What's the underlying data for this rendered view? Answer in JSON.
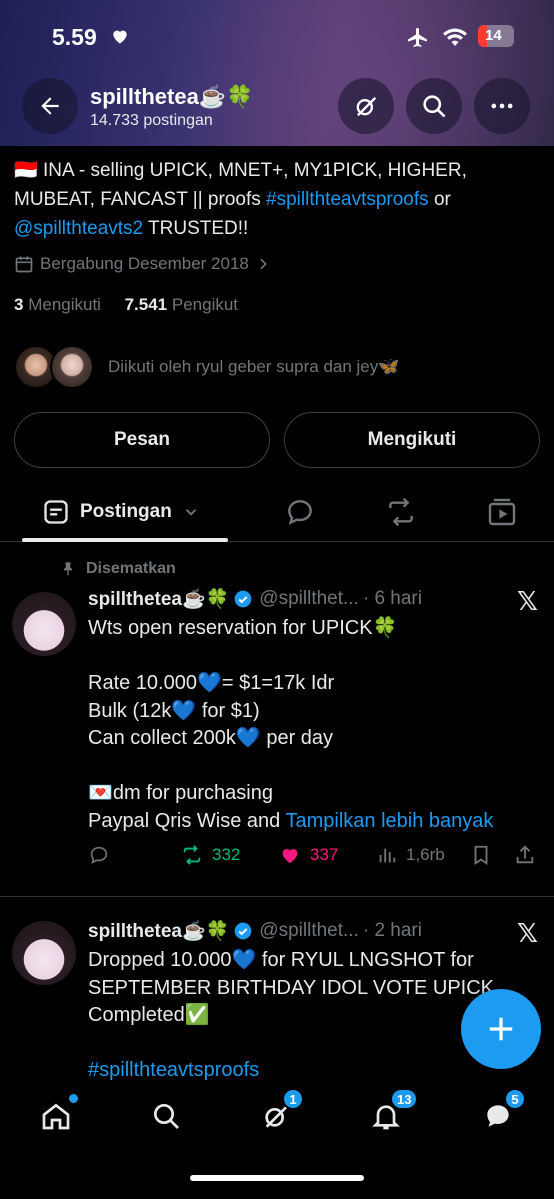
{
  "status_bar": {
    "time": "5.59",
    "battery": "14"
  },
  "header": {
    "name": "spillthetea☕️🍀",
    "post_count": "14.733 postingan"
  },
  "profile": {
    "bio_flag": "🇮🇩",
    "bio_line1": " INA - selling UPICK, MNET+, MY1PICK, HIGHER,",
    "bio_line2_a": "MUBEAT, FANCAST || proofs ",
    "bio_hashtag": "#spillthteavtsproofs",
    "bio_line2_b": " or",
    "bio_mention": "@spillthteavts2",
    "bio_line3_b": " TRUSTED!!",
    "joined": "Bergabung Desember 2018",
    "following_count": "3",
    "following_label": "Mengikuti",
    "followers_count": "7.541",
    "followers_label": "Pengikut",
    "followed_by": "Diikuti oleh ryul geber supra dan jey🦋",
    "message_button": "Pesan",
    "following_button": "Mengikuti"
  },
  "tabs": {
    "active_label": "Postingan"
  },
  "posts": [
    {
      "pinned_label": "Disematkan",
      "name": "spillthetea☕️🍀",
      "handle": "@spillthet...",
      "time": "· 6 hari",
      "lines": [
        "Wts  open reservation for UPICK🍀",
        "",
        "Rate 10.000💙= $1=17k Idr",
        "Bulk (12k💙  for $1)",
        "Can collect 200k💙  per day",
        "",
        "💌dm for purchasing"
      ],
      "last_line": "Paypal Qris Wise and ",
      "show_more": "Tampilkan lebih banyak",
      "retweets": "332",
      "likes": "337",
      "views": "1,6rb"
    },
    {
      "name": "spillthetea☕️🍀",
      "handle": "@spillthet...",
      "time": "· 2 hari",
      "lines": [
        "Dropped 10.000💙  for RYUL LNGSHOT for",
        "SEPTEMBER BIRTHDAY IDOL VOTE UPICK",
        "Completed✅",
        ""
      ],
      "hashtag": "#spillthteavtsproofs"
    }
  ],
  "nav": {
    "grok_badge": "1",
    "notif_badge": "13",
    "msg_badge": "5"
  },
  "colors": {
    "accent": "#1d9bf0",
    "retweet": "#00ba7c",
    "like": "#f91880",
    "muted": "#71767b"
  }
}
